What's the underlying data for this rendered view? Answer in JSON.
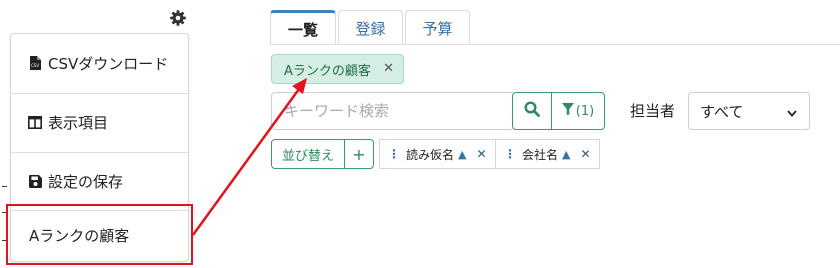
{
  "menu": {
    "items": [
      {
        "label": "CSVダウンロード",
        "icon": "csv-file-icon"
      },
      {
        "label": "表示項目",
        "icon": "columns-icon"
      },
      {
        "label": "設定の保存",
        "icon": "save-icon"
      },
      {
        "label": "Aランクの顧客",
        "icon": ""
      }
    ]
  },
  "tabs": [
    {
      "label": "一覧",
      "active": true
    },
    {
      "label": "登録",
      "active": false
    },
    {
      "label": "予算",
      "active": false
    }
  ],
  "filter_chip": {
    "label": "Aランクの顧客",
    "remove": "✕"
  },
  "search": {
    "placeholder": "キーワード検索",
    "value": ""
  },
  "filter_button": {
    "count_label": "(1)"
  },
  "assignee": {
    "label": "担当者",
    "selected": "すべて"
  },
  "sort": {
    "button_label": "並び替え",
    "add_label": "+",
    "keys": [
      {
        "label": "読み仮名",
        "direction": "▲",
        "remove": "✕"
      },
      {
        "label": "会社名",
        "direction": "▲",
        "remove": "✕"
      }
    ]
  },
  "colors": {
    "accent_green": "#3a9b6a",
    "link_blue": "#3573a8",
    "chip_bg": "#d5eee3",
    "annotation_red": "#e0141a"
  }
}
